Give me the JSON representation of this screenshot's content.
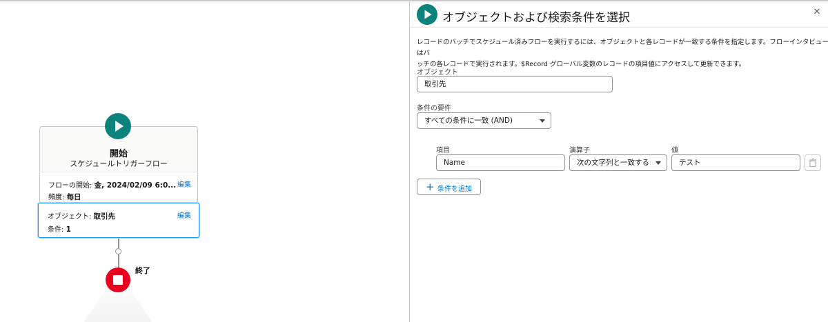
{
  "canvas": {
    "start": {
      "title": "開始",
      "subtitle": "スケジュールトリガーフロー",
      "icon": "play-icon"
    },
    "schedule": {
      "start_label": "フローの開始:",
      "start_value": "金, 2024/02/09 6:0...",
      "frequency_label": "頻度:",
      "frequency_value": "毎日",
      "edit_label": "編集"
    },
    "object_card": {
      "object_label": "オブジェクト:",
      "object_value": "取引先",
      "conditions_label": "条件:",
      "conditions_value": "1",
      "edit_label": "編集"
    },
    "end": {
      "label": "終了",
      "icon": "stop-icon"
    }
  },
  "panel": {
    "title": "オブジェクトおよび検索条件を選択",
    "close_icon": "close-icon",
    "description_line1": "レコードのバッチでスケジュール済みフローを実行するには、オブジェクトと各レコードが一致する条件を指定します。フローインタビューはバ",
    "description_line2": "ッチの各レコードで実行されます。$Record グローバル変数のレコードの項目値にアクセスして更新できます。",
    "object": {
      "label": "オブジェクト",
      "value": "取引先"
    },
    "condition_requirements": {
      "label": "条件の要件",
      "selected": "すべての条件に一致 (AND)"
    },
    "condition_table": {
      "headers": {
        "field": "項目",
        "operator": "演算子",
        "value": "値"
      },
      "rows": [
        {
          "field": "Name",
          "operator": "次の文字列と一致する",
          "value": "テスト"
        }
      ]
    },
    "add_condition_label": "条件を追加"
  },
  "colors": {
    "start_icon": "#0b827c",
    "end_icon": "#ea001e",
    "link": "#0176d3",
    "focus_border": "#1b96ff"
  }
}
